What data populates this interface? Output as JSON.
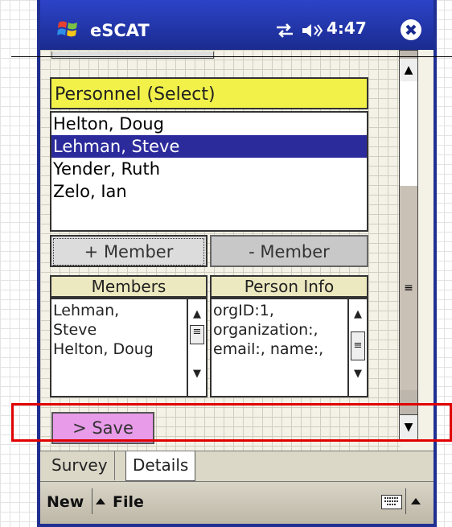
{
  "app": {
    "title": "eSCAT",
    "time": "4:47",
    "colors": {
      "accent": "#1f2f92",
      "selection": "#2b2b9c",
      "header_yellow": "#f1f14a",
      "save_pink": "#e89be8",
      "highlight_red": "#e00000"
    }
  },
  "personnel": {
    "header": "Personnel (Select)",
    "items": [
      "Helton, Doug",
      "Lehman, Steve",
      "Yender, Ruth",
      "Zelo, Ian"
    ],
    "selected": "Lehman, Steve"
  },
  "buttons": {
    "add_member": "+ Member",
    "remove_member": "- Member",
    "save": "> Save"
  },
  "members": {
    "header": "Members",
    "lines": [
      "Lehman,",
      "Steve",
      "Helton, Doug"
    ]
  },
  "person_info": {
    "header": "Person Info",
    "lines": [
      "orgID:1,",
      "organization:,",
      "email:, name:,"
    ]
  },
  "tabs": [
    "Survey",
    "Details"
  ],
  "active_tab": "Details",
  "menu": {
    "new": "New",
    "file": "File"
  },
  "icons": [
    "windows-logo-icon",
    "connectivity-icon",
    "speaker-icon",
    "close-icon",
    "keyboard-icon",
    "arrow-up-icon",
    "arrow-down-icon",
    "grip-icon"
  ]
}
